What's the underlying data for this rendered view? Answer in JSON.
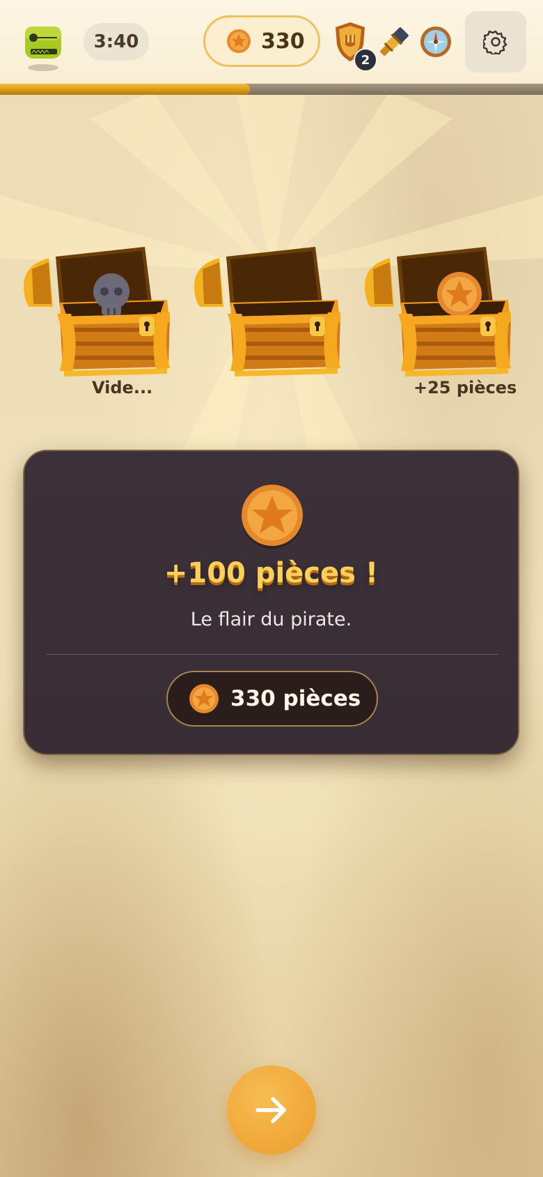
{
  "header": {
    "timer": "3:40",
    "coins": "330",
    "level_badge": "2",
    "icons": {
      "logo": "tape-measure-icon",
      "coin": "coin-icon",
      "shield": "shield-icon",
      "telescope": "telescope-icon",
      "compass": "compass-icon",
      "settings": "gear-icon"
    },
    "progress_fraction": 0.46
  },
  "chests": [
    {
      "content": "skull",
      "label": "Vide..."
    },
    {
      "content": "empty",
      "label": ""
    },
    {
      "content": "coin",
      "label": "+25 pièces"
    }
  ],
  "result": {
    "title": "+100 pièces !",
    "subtitle": "Le flair du pirate.",
    "total": "330 pièces"
  },
  "next_button": {
    "icon": "arrow-right-icon"
  },
  "colors": {
    "accent": "#f1a93a",
    "card_bg": "#3b2f37",
    "title_gold": "#ffcf5c",
    "text_dark": "#4b3320"
  }
}
